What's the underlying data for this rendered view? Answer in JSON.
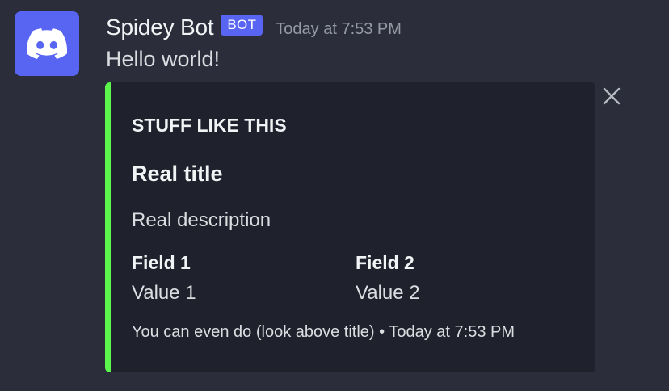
{
  "message": {
    "author": {
      "name": "Spidey Bot",
      "tag": "BOT",
      "avatar_icon": "discord-logo-icon",
      "avatar_color": "#5865f2"
    },
    "timestamp": "Today at 7:53 PM",
    "content": "Hello world!"
  },
  "embed": {
    "accent_color": "#5af64c",
    "author": "STUFF LIKE THIS",
    "title": "Real title",
    "description": "Real description",
    "fields": [
      {
        "name": "Field 1",
        "value": "Value 1"
      },
      {
        "name": "Field 2",
        "value": "Value 2"
      }
    ],
    "footer": {
      "text": "You can even do (look above title)",
      "separator": "•",
      "timestamp": "Today at 7:53 PM"
    },
    "dismiss_icon": "close-icon"
  }
}
